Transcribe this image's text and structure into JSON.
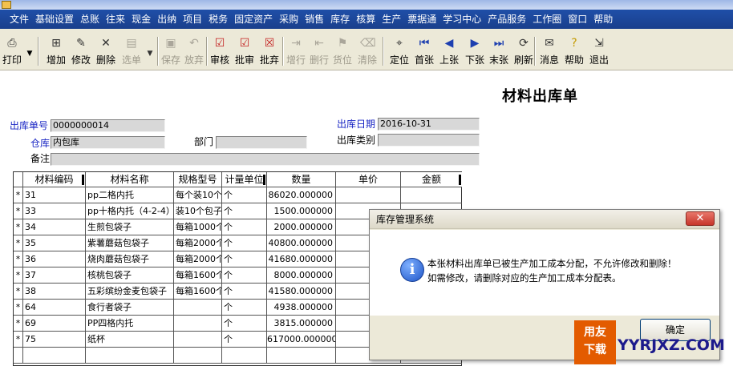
{
  "menu": [
    "文件",
    "基础设置",
    "总账",
    "往来",
    "现金",
    "出纳",
    "项目",
    "税务",
    "固定资产",
    "采购",
    "销售",
    "库存",
    "核算",
    "生产",
    "票据通",
    "学习中心",
    "产品服务",
    "工作圈",
    "窗口",
    "帮助"
  ],
  "toolbar": [
    {
      "label": "打印",
      "icon": "printer-icon",
      "enabled": true
    },
    {
      "label": "增加",
      "icon": "add-document-icon",
      "enabled": true
    },
    {
      "label": "修改",
      "icon": "edit-icon",
      "enabled": true
    },
    {
      "label": "删除",
      "icon": "delete-x-icon",
      "enabled": true
    },
    {
      "label": "选单",
      "icon": "select-document-icon",
      "enabled": false
    },
    {
      "label": "保存",
      "icon": "save-icon",
      "enabled": false
    },
    {
      "label": "放弃",
      "icon": "discard-icon",
      "enabled": false
    },
    {
      "label": "审核",
      "icon": "audit-icon",
      "enabled": true
    },
    {
      "label": "批审",
      "icon": "batch-audit-icon",
      "enabled": true
    },
    {
      "label": "批弃",
      "icon": "batch-discard-icon",
      "enabled": true
    },
    {
      "label": "增行",
      "icon": "add-row-icon",
      "enabled": false
    },
    {
      "label": "删行",
      "icon": "delete-row-icon",
      "enabled": false
    },
    {
      "label": "货位",
      "icon": "location-icon",
      "enabled": false
    },
    {
      "label": "清除",
      "icon": "clear-icon",
      "enabled": false
    },
    {
      "label": "定位",
      "icon": "locate-icon",
      "enabled": true
    },
    {
      "label": "首张",
      "icon": "first-record-icon",
      "enabled": true
    },
    {
      "label": "上张",
      "icon": "previous-record-icon",
      "enabled": true
    },
    {
      "label": "下张",
      "icon": "next-record-icon",
      "enabled": true
    },
    {
      "label": "末张",
      "icon": "last-record-icon",
      "enabled": true
    },
    {
      "label": "刷新",
      "icon": "refresh-icon",
      "enabled": true
    },
    {
      "label": "消息",
      "icon": "message-icon",
      "enabled": true
    },
    {
      "label": "帮助",
      "icon": "help-icon",
      "enabled": true
    },
    {
      "label": "退出",
      "icon": "exit-icon",
      "enabled": true
    }
  ],
  "form": {
    "title": "材料出库单",
    "doc_no_label": "出库单号",
    "doc_no": "0000000014",
    "date_label": "出库日期",
    "date": "2016-10-31",
    "warehouse_label": "仓库",
    "warehouse": "内包库",
    "dept_label": "部门",
    "dept": "",
    "type_label": "出库类别",
    "type": "",
    "remark_label": "备注",
    "remark": ""
  },
  "grid": {
    "headers": [
      "材料编码",
      "材料名称",
      "规格型号",
      "计量单位",
      "数量",
      "单价",
      "金额"
    ],
    "rows": [
      {
        "mark": "*",
        "code": "31",
        "name": "pp二格内托",
        "spec": "每个装10个",
        "unit": "个",
        "qty": "86020.000000",
        "price": "",
        "amount": ""
      },
      {
        "mark": "*",
        "code": "33",
        "name": "pp十格内托（4-2-4）",
        "spec": "装10个包子",
        "unit": "个",
        "qty": "1500.000000",
        "price": "",
        "amount": ""
      },
      {
        "mark": "*",
        "code": "34",
        "name": "生煎包袋子",
        "spec": "每箱1000个",
        "unit": "个",
        "qty": "2000.000000",
        "price": "",
        "amount": ""
      },
      {
        "mark": "*",
        "code": "35",
        "name": "紫薯蘑菇包袋子",
        "spec": "每箱2000个",
        "unit": "个",
        "qty": "40800.000000",
        "price": "",
        "amount": ""
      },
      {
        "mark": "*",
        "code": "36",
        "name": "烧肉蘑菇包袋子",
        "spec": "每箱2000个",
        "unit": "个",
        "qty": "41680.000000",
        "price": "",
        "amount": ""
      },
      {
        "mark": "*",
        "code": "37",
        "name": "核桃包袋子",
        "spec": "每箱1600个",
        "unit": "个",
        "qty": "8000.000000",
        "price": "",
        "amount": ""
      },
      {
        "mark": "*",
        "code": "38",
        "name": "五彩缤纷金麦包袋子",
        "spec": "每箱1600个",
        "unit": "个",
        "qty": "41580.000000",
        "price": "",
        "amount": ""
      },
      {
        "mark": "*",
        "code": "64",
        "name": "食行者袋子",
        "spec": "",
        "unit": "个",
        "qty": "4938.000000",
        "price": "",
        "amount": ""
      },
      {
        "mark": "*",
        "code": "69",
        "name": "PP四格内托",
        "spec": "",
        "unit": "个",
        "qty": "3815.000000",
        "price": "",
        "amount": ""
      },
      {
        "mark": "*",
        "code": "75",
        "name": "纸杯",
        "spec": "",
        "unit": "个",
        "qty": "617000.000000",
        "price": "",
        "amount": ""
      }
    ]
  },
  "dialog": {
    "title": "库存管理系统",
    "line1": "本张材料出库单已被生产加工成本分配，不允许修改和删除！",
    "line2": "如需修改，请删除对应的生产加工成本分配表。",
    "ok": "确定",
    "close": "✕"
  },
  "watermark": {
    "top": "用友",
    "bottom": "下载",
    "site": "YYRJXZ.COM"
  },
  "colors": {
    "menubar": "#1f4fa8",
    "toolbar": "#ece9d8",
    "label_blue": "#1a26c4",
    "close_red": "#c7352a",
    "watermark_orange": "#e35b00"
  }
}
